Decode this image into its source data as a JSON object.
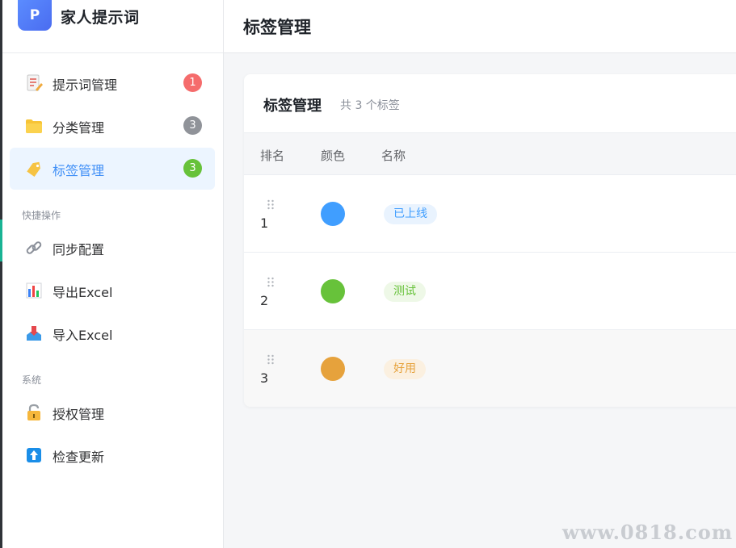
{
  "brand": {
    "logo_letter": "P",
    "title": "家人提示词"
  },
  "sidebar": {
    "items": [
      {
        "label": "提示词管理",
        "badge": "1",
        "badge_color": "#f56c6c",
        "icon": "prompt-document-icon"
      },
      {
        "label": "分类管理",
        "badge": "3",
        "badge_color": "#909399",
        "icon": "folder-icon"
      },
      {
        "label": "标签管理",
        "badge": "3",
        "badge_color": "#67c23a",
        "icon": "tag-icon",
        "active": true
      }
    ],
    "quick_section": "快捷操作",
    "quick_items": [
      {
        "label": "同步配置",
        "icon": "link-icon"
      },
      {
        "label": "导出Excel",
        "icon": "bar-chart-icon"
      },
      {
        "label": "导入Excel",
        "icon": "import-icon"
      }
    ],
    "system_section": "系统",
    "system_items": [
      {
        "label": "授权管理",
        "icon": "lock-icon"
      },
      {
        "label": "检查更新",
        "icon": "upload-arrow-icon"
      }
    ]
  },
  "header": {
    "title": "标签管理"
  },
  "card": {
    "title": "标签管理",
    "subtitle": "共 3 个标签",
    "columns": [
      "排名",
      "颜色",
      "名称"
    ],
    "rows": [
      {
        "rank": "1",
        "color": "#409eff",
        "name": "已上线",
        "tag_bg": "#e9f3fe",
        "tag_fg": "#409eff"
      },
      {
        "rank": "2",
        "color": "#67c23a",
        "name": "测试",
        "tag_bg": "#eef8e7",
        "tag_fg": "#67c23a"
      },
      {
        "rank": "3",
        "color": "#e6a23c",
        "name": "好用",
        "tag_bg": "#fbf0e0",
        "tag_fg": "#e6a23c"
      }
    ]
  },
  "watermark": "www.0818.com",
  "colors": {
    "accent": "#3f8ff7",
    "active_bg": "#ecf5ff"
  }
}
